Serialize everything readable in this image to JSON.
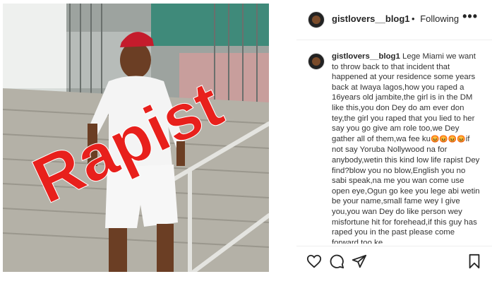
{
  "post": {
    "overlay_text": "Rapist"
  },
  "header": {
    "username": "gistlovers__blog1",
    "separator": "•",
    "follow_status": "Following",
    "more_label": "•••"
  },
  "comment": {
    "username": "gistlovers__blog1",
    "text_before_emoji": "Lege Miami we want to throw back to that incident that happened at your residence some years back at Iwaya lagos,how you raped a 16years old jambite,the girl is in the DM like this,you don Dey do am ever don tey,the girl you raped that you lied to her say you go give am role too,we Dey gather all of them,wa fee ku",
    "emojis": "😡😡😡😡",
    "text_after_emoji": "if not say Yoruba Nollywood na for anybody,wetin this kind low life rapist Dey find?blow you no blow,English you no sabi speak,na me you wan come use open eye,Ogun go kee you lege abi wetin be your name,small fame wey I give you,you wan Dey do like person wey misfortune hit for forehead,if this guy has raped you in the past please come forward too ke"
  },
  "actions": {
    "like_icon": "heart-icon",
    "comment_icon": "comment-icon",
    "share_icon": "share-icon",
    "save_icon": "bookmark-icon"
  },
  "colors": {
    "overlay_red": "#e8201c",
    "cap_red": "#c41c2c"
  }
}
